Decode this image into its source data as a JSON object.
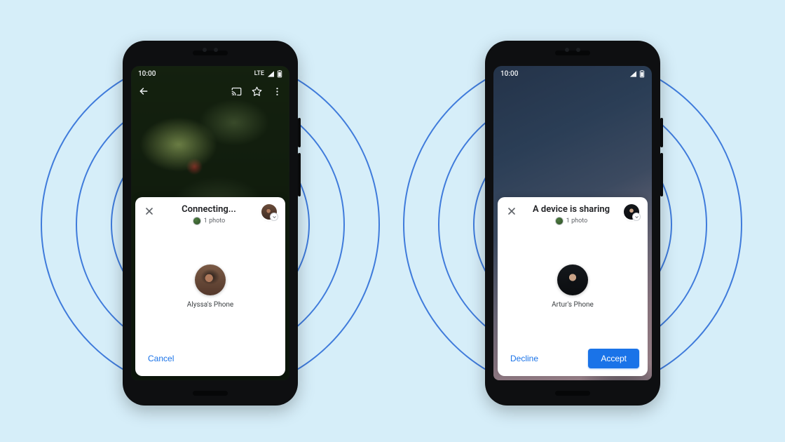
{
  "colors": {
    "page_bg": "#d6eef9",
    "ring": "#2566d6",
    "accent": "#1a73e8"
  },
  "status": {
    "time": "10:00",
    "network_label": "LTE"
  },
  "left": {
    "sheet": {
      "title": "Connecting...",
      "sub_label": "1 photo",
      "contact_name": "Alyssa's Phone",
      "cancel_label": "Cancel"
    }
  },
  "right": {
    "sheet": {
      "title": "A device is sharing",
      "sub_label": "1 photo",
      "contact_name": "Artur's Phone",
      "decline_label": "Decline",
      "accept_label": "Accept"
    }
  }
}
